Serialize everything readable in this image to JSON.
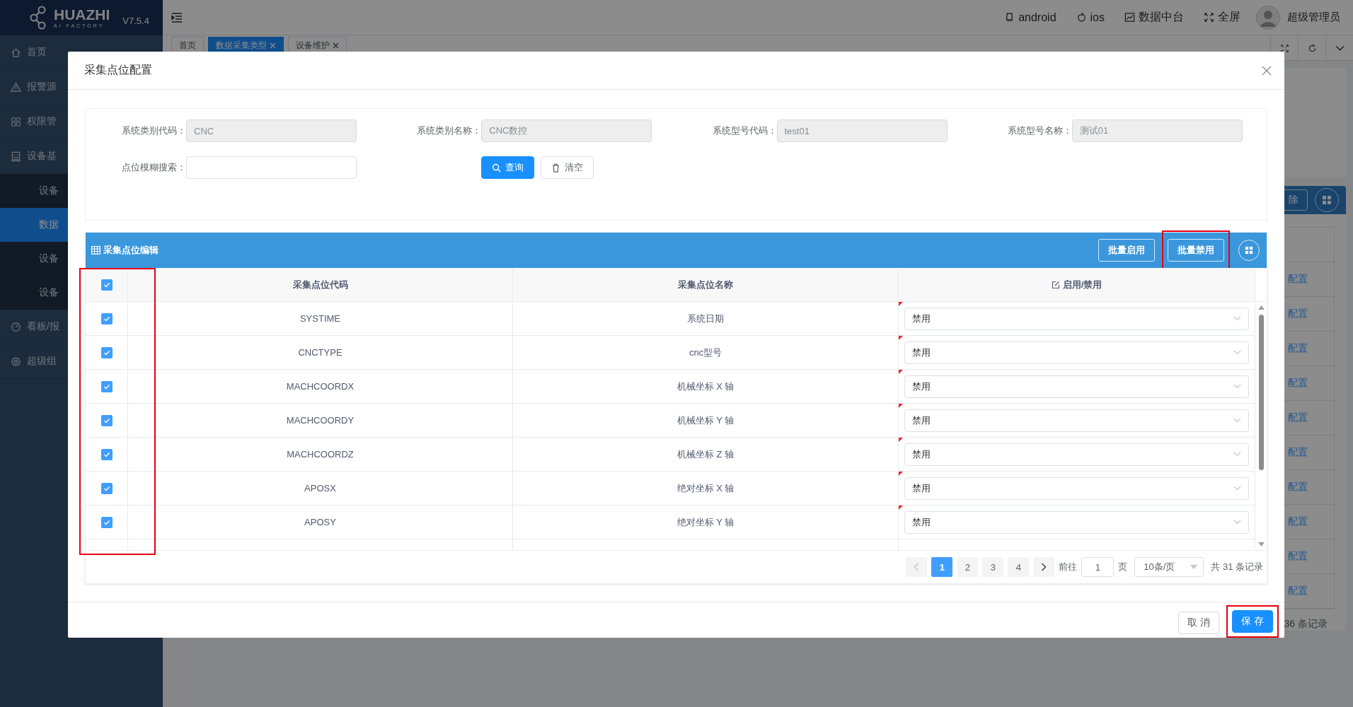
{
  "sidebar": {
    "logo": "HUAZHI",
    "logo_tagline": "AI FACTORY",
    "version": "V7.5.4",
    "items": [
      {
        "label": "首页"
      },
      {
        "label": "报警源"
      },
      {
        "label": "权限管"
      },
      {
        "label": "设备基",
        "children": [
          {
            "label": "设备",
            "selected": false
          },
          {
            "label": "数据",
            "selected": true
          },
          {
            "label": "设备",
            "selected": false
          },
          {
            "label": "设备",
            "selected": false
          }
        ]
      },
      {
        "label": "看板/报"
      },
      {
        "label": "超级组"
      }
    ]
  },
  "header": {
    "links": [
      {
        "label": "android"
      },
      {
        "label": "ios"
      },
      {
        "label": "数据中台"
      },
      {
        "label": "全屏"
      }
    ],
    "user": "超级管理员"
  },
  "tabs": [
    {
      "label": "首页",
      "selected": false,
      "closable": false
    },
    {
      "label": "数据采集类型",
      "selected": true,
      "closable": true
    },
    {
      "label": "设备维护",
      "selected": false,
      "closable": true
    }
  ],
  "background_panel": {
    "action": "除",
    "links": [
      "配置",
      "配置",
      "配置",
      "配置",
      "配置",
      "配置",
      "配置",
      "配置",
      "配置",
      "配置"
    ],
    "total": "36 条记录"
  },
  "dialog": {
    "title": "采集点位配置",
    "fields": [
      {
        "label": "系统类别代码：",
        "value": "CNC",
        "disabled": true
      },
      {
        "label": "系统类别名称：",
        "value": "CNC数控",
        "disabled": true
      },
      {
        "label": "系统型号代码：",
        "value": "test01",
        "disabled": true
      },
      {
        "label": "系统型号名称：",
        "value": "测试01",
        "disabled": true
      }
    ],
    "search": {
      "label": "点位模糊搜索："
    },
    "query_button": "查询",
    "clear_button": "清空",
    "table": {
      "title": "采集点位编辑",
      "actions": [
        {
          "label": "批量启用",
          "highlighted": false
        },
        {
          "label": "批量禁用",
          "highlighted": true
        }
      ],
      "select_all": true,
      "checkbox_column_highlighted": true,
      "columns": [
        "采集点位代码",
        "采集点位名称",
        "启用/禁用"
      ],
      "rows": [
        {
          "checked": true,
          "code": "SYSTIME",
          "name": "系统日期",
          "status": "禁用",
          "edited": true
        },
        {
          "checked": true,
          "code": "CNCTYPE",
          "name": "cnc型号",
          "status": "禁用",
          "edited": true
        },
        {
          "checked": true,
          "code": "MACHCOORDX",
          "name": "机械坐标 X 轴",
          "status": "禁用",
          "edited": true
        },
        {
          "checked": true,
          "code": "MACHCOORDY",
          "name": "机械坐标 Y 轴",
          "status": "禁用",
          "edited": true
        },
        {
          "checked": true,
          "code": "MACHCOORDZ",
          "name": "机械坐标 Z 轴",
          "status": "禁用",
          "edited": true
        },
        {
          "checked": true,
          "code": "APOSX",
          "name": "绝对坐标 X 轴",
          "status": "禁用",
          "edited": true
        },
        {
          "checked": true,
          "code": "APOSY",
          "name": "绝对坐标 Y 轴",
          "status": "禁用",
          "edited": true
        }
      ],
      "pagination": {
        "prev_disabled": true,
        "pages": [
          {
            "label": "1",
            "selected": true
          },
          {
            "label": "2",
            "selected": false
          },
          {
            "label": "3",
            "selected": false
          },
          {
            "label": "4",
            "selected": false
          }
        ],
        "goto_label": "前往",
        "goto_value": "1",
        "page_unit": "页",
        "page_size": "10条/页",
        "total": "共 31 条记录"
      }
    },
    "footer_buttons": [
      {
        "label": "取 消",
        "kind": "default",
        "highlighted": false
      },
      {
        "label": "保 存",
        "kind": "primary",
        "highlighted": true
      }
    ]
  }
}
